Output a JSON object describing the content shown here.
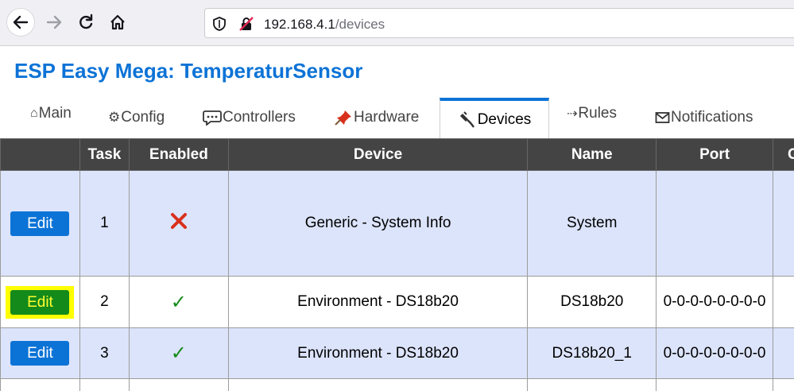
{
  "browser": {
    "url_host": "192.168.4.1",
    "url_path": "/devices"
  },
  "page": {
    "title": "ESP Easy Mega: TemperaturSensor"
  },
  "menu": {
    "items": [
      {
        "label": "Main",
        "icon": "home-icon"
      },
      {
        "label": "Config",
        "icon": "gear-icon"
      },
      {
        "label": "Controllers",
        "icon": "speech-bubble-icon"
      },
      {
        "label": "Hardware",
        "icon": "pushpin-icon"
      },
      {
        "label": "Devices",
        "icon": "plug-icon",
        "active": true
      },
      {
        "label": "Rules",
        "icon": "arrow-icon"
      },
      {
        "label": "Notifications",
        "icon": "envelope-icon"
      }
    ]
  },
  "table": {
    "headers": [
      "",
      "Task",
      "Enabled",
      "Device",
      "Name",
      "Port",
      "G"
    ],
    "rows": [
      {
        "edit": "Edit",
        "task": "1",
        "enabled": false,
        "device": "Generic - System Info",
        "name": "System",
        "port": ""
      },
      {
        "edit": "Edit",
        "task": "2",
        "enabled": true,
        "device": "Environment - DS18b20",
        "name": "DS18b20",
        "port": "0-0-0-0-0-0-0-0"
      },
      {
        "edit": "Edit",
        "task": "3",
        "enabled": true,
        "device": "Environment - DS18b20",
        "name": "DS18b20_1",
        "port": "0-0-0-0-0-0-0-0"
      }
    ]
  },
  "colors": {
    "accent": "#0c73d6",
    "header_bg": "#444444",
    "row_odd": "#dce4fb",
    "highlight": "#ffff00",
    "check": "#138a1a",
    "cross": "#d9301c"
  }
}
